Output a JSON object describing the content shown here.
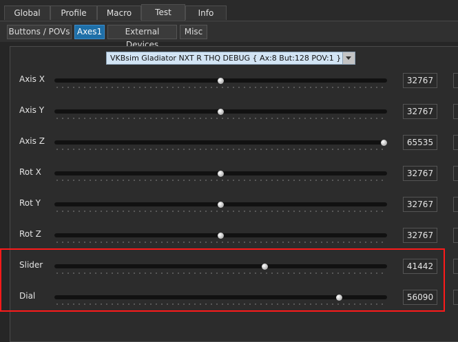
{
  "main_tabs": [
    {
      "label": "Global"
    },
    {
      "label": "Profile"
    },
    {
      "label": "Macro"
    },
    {
      "label": "Test"
    },
    {
      "label": "Info"
    }
  ],
  "sub_tabs": [
    {
      "label": "Buttons / POVs"
    },
    {
      "label": "Axes1"
    },
    {
      "label": "External Devices"
    },
    {
      "label": "Misc"
    }
  ],
  "active_main_tab": "Test",
  "active_sub_tab": "Axes1",
  "device": {
    "selected": "VKBsim Gladiator NXT R THQ DEBUG  { Ax:8 But:128 POV:1 }"
  },
  "axes": [
    {
      "label": "Axis X",
      "value": "32767",
      "fraction": 0.5
    },
    {
      "label": "Axis Y",
      "value": "32767",
      "fraction": 0.5
    },
    {
      "label": "Axis Z",
      "value": "65535",
      "fraction": 1.0
    },
    {
      "label": "Rot X",
      "value": "32767",
      "fraction": 0.5
    },
    {
      "label": "Rot Y",
      "value": "32767",
      "fraction": 0.5
    },
    {
      "label": "Rot Z",
      "value": "32767",
      "fraction": 0.5
    },
    {
      "label": "Slider",
      "value": "41442",
      "fraction": 0.6324
    },
    {
      "label": "Dial",
      "value": "56090",
      "fraction": 0.8559
    }
  ],
  "colors": {
    "accent": "#1e6fa8",
    "highlight": "#ff1a1a"
  }
}
